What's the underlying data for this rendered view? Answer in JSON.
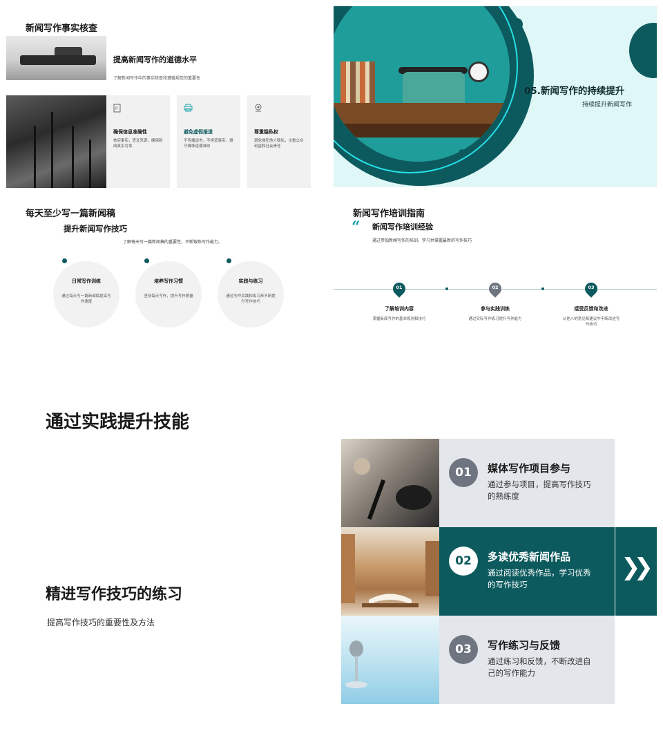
{
  "slide1": {
    "title": "新闻写作事实核查",
    "main_heading": "提高新闻写作的道德水平",
    "main_text": "了解新闻写作中的事实核查和遵循规范的重要性",
    "cards": [
      {
        "icon": "document-icon",
        "heading": "确保信息准确性",
        "text": "核实事实，查证来源，确保新闻真实可靠"
      },
      {
        "icon": "printer-icon",
        "heading": "避免虚假报道",
        "text": "不传播谣言，不捏造事实，遵守媒体道德准则"
      },
      {
        "icon": "location-icon",
        "heading": "尊重隐私权",
        "text": "避免侵犯他人隐私，注重公众利益和社会责任"
      }
    ],
    "accent_heading_color": "#0d5a5e"
  },
  "slide2": {
    "heading": "05.新闻写作的持续提升",
    "subheading": "持续提升新闻写作",
    "colors": {
      "background": "#dff7f7",
      "primary": "#0d5a5e",
      "ring": "#26e0e8"
    }
  },
  "slide3": {
    "title": "每天至少写一篇新闻稿",
    "subtitle": "提升新闻写作技巧",
    "description": "了解每天写一篇新闻稿的重要性，不断锻炼写作能力。",
    "circles": [
      {
        "heading": "日常写作训练",
        "text": "通过每天写一篇新闻稿提高写作速度"
      },
      {
        "heading": "培养写作习惯",
        "text": "坚持每天写作，提升写作质量"
      },
      {
        "heading": "实践与练习",
        "text": "通过写作实践和练习来不断提升写作技巧"
      }
    ]
  },
  "slide4": {
    "title": "新闻写作培训指南",
    "quote_mark": "“",
    "subtitle": "新闻写作培训经验",
    "description": "通过参加新闻写作的培训，学习并掌握最新的写作技巧",
    "steps": [
      {
        "num": "01",
        "heading": "了解培训内容",
        "text": "掌握新闻写作的基本规则和技巧",
        "color": "#0d5a5e"
      },
      {
        "num": "02",
        "heading": "参与实践训练",
        "text": "通过实际写作练习提升写作能力",
        "color": "#6f7580"
      },
      {
        "num": "03",
        "heading": "接受反馈和改进",
        "text": "从他人的意见和建议中不断改进写作技巧",
        "color": "#0d5a5e"
      }
    ]
  },
  "slide5": {
    "heading": "通过实践提升技能",
    "section_title": "精进写作技巧的练习",
    "section_subtitle": "提高写作技巧的重要性及方法",
    "rows": [
      {
        "num": "01",
        "heading": "媒体写作项目参与",
        "text": "通过参与项目，提高写作技巧的熟练度",
        "active": false
      },
      {
        "num": "02",
        "heading": "多读优秀新闻作品",
        "text": "通过阅读优秀作品，学习优秀的写作技巧",
        "active": true
      },
      {
        "num": "03",
        "heading": "写作练习与反馈",
        "text": "通过练习和反馈，不断改进自己的写作能力",
        "active": false
      }
    ],
    "arrow_icon": "double-chevron-right-icon"
  }
}
